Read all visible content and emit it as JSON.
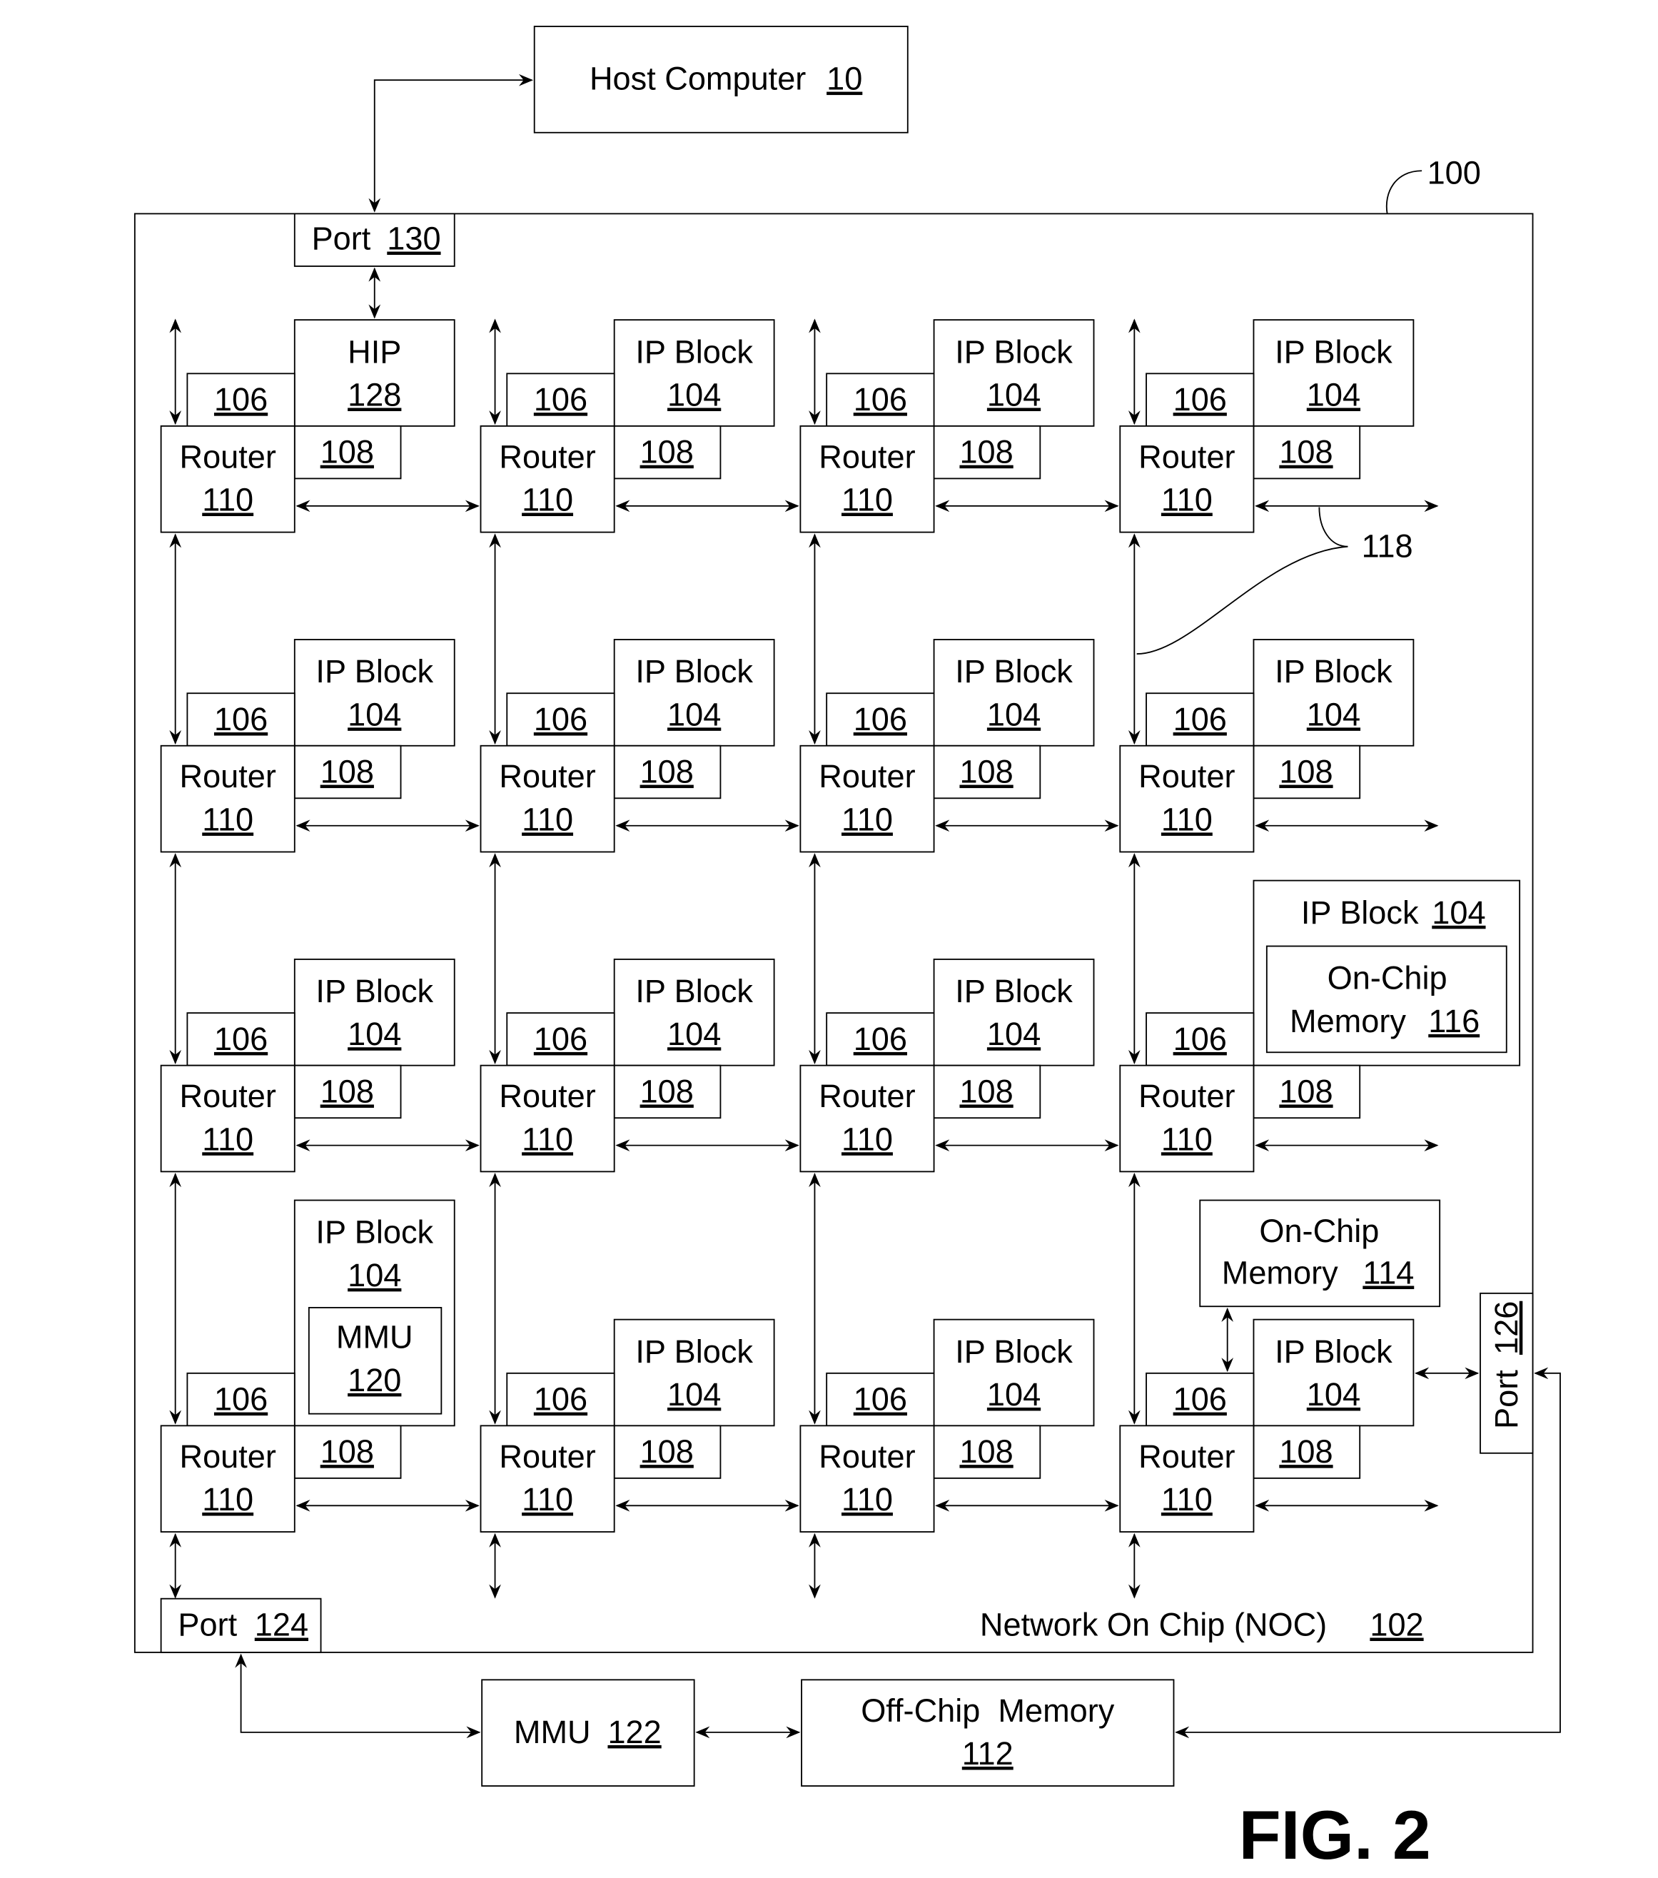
{
  "figure": {
    "caption": "FIG. 2",
    "system_ref": "100",
    "link_ref": "118"
  },
  "host": {
    "label": "Host Computer",
    "ref": "10"
  },
  "noc": {
    "label": "Network On Chip (NOC)",
    "ref": "102"
  },
  "ports": {
    "p130": {
      "label": "Port",
      "ref": "130"
    },
    "p124": {
      "label": "Port",
      "ref": "124"
    },
    "p126": {
      "label": "Port",
      "ref": "126"
    }
  },
  "external": {
    "mmu122": {
      "label": "MMU",
      "ref": "122"
    },
    "offchip": {
      "label": "Off-Chip  Memory",
      "ref": "112"
    }
  },
  "onchip114": {
    "line1": "On-Chip",
    "line2": "Memory",
    "ref": "114"
  },
  "onchip116": {
    "line1": "On-Chip",
    "line2": "Memory",
    "ref": "116"
  },
  "mmu120": {
    "label": "MMU",
    "ref": "120"
  },
  "node_labels": {
    "router": "Router",
    "router_ref": "110",
    "ni_ref": "106",
    "mc_ref": "108",
    "ip": "IP Block",
    "ip_ref": "104",
    "hip": "HIP",
    "hip_ref": "128"
  },
  "grid": {
    "rows": 4,
    "cols": 4,
    "nodes": [
      [
        "hip",
        "ip",
        "ip",
        "ip"
      ],
      [
        "ip",
        "ip",
        "ip",
        "ip"
      ],
      [
        "ip",
        "ip",
        "ip",
        "ip-onchip116"
      ],
      [
        "ip-mmu120",
        "ip",
        "ip",
        "ip"
      ]
    ]
  }
}
